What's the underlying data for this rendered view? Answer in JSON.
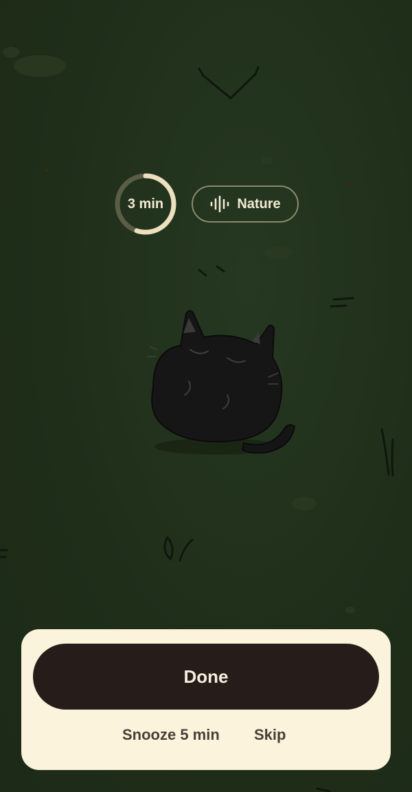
{
  "timer": {
    "label": "3 min",
    "progress": 0.55
  },
  "sound": {
    "label": "Nature",
    "icon": "waveform-icon"
  },
  "actions": {
    "done_label": "Done",
    "snooze_label": "Snooze 5 min",
    "skip_label": "Skip"
  },
  "colors": {
    "background": "#1f2e19",
    "sheet": "#fcf3dc",
    "done_button": "#261d1b",
    "accent": "#f3ead2"
  }
}
